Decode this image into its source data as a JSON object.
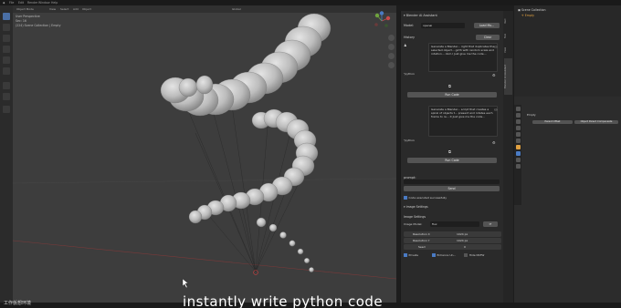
{
  "menubar": {
    "items": [
      "File",
      "Edit",
      "Render",
      "Window",
      "Help"
    ],
    "workspace": "Object Mode",
    "view_items": [
      "View",
      "Select",
      "Add",
      "Object"
    ],
    "transform": "Global"
  },
  "viewport": {
    "view_label": "User Perspective",
    "collection_label": "(224) Scene Collection | Empty",
    "frame_counter": "Sec: 16"
  },
  "ai_panel": {
    "title": "Blender AI Assistant",
    "model_label": "Model:",
    "model_value": "openai",
    "load_models_label": "Load Mo...",
    "history_label": "History",
    "clear_label": "Clear",
    "messages": [
      {
        "role": "user",
        "text": "Generate a Blender... right that duplicates the selected object... girth with random scale and rotation... dom.I Just give me the code..."
      },
      {
        "role": "assistant",
        "code_label": "\"python"
      },
      {
        "role": "user",
        "text": "Generate a Blender... script that creates a spiral of objects t... present and rotates each frame to re... it Just give me the code..."
      },
      {
        "role": "assistant",
        "code_label": "\"python"
      }
    ],
    "run_code_label": "Run Code",
    "prompt_label": "prompt:",
    "send_label": "Send",
    "status_text": "Code executed successfully",
    "image_settings_section": "Image Settings",
    "image_settings_label": "Image Settings",
    "image_model_label": "Image Model:",
    "image_model_value": "flux",
    "resolution_x_label": "Resolution X",
    "resolution_x_value": "1024 px",
    "resolution_y_label": "Resolution Y",
    "resolution_y_value": "1024 px",
    "seed_label": "Seed",
    "seed_value": "0",
    "private_label": "Private",
    "enhance_label": "Enhance Un...",
    "nsfw_label": "Hide NSFW"
  },
  "side_tabs": [
    "Item",
    "Tool",
    "View",
    "Blender AI Assistant"
  ],
  "outliner": {
    "title": "Scene Collection",
    "item": "Empty"
  },
  "properties": {
    "object_name": "Empty",
    "parent_buttons": [
      "Parent Offset",
      "Object Parent Compensate"
    ]
  },
  "caption": "instantly write python code",
  "watermark": "工作仮想环境"
}
